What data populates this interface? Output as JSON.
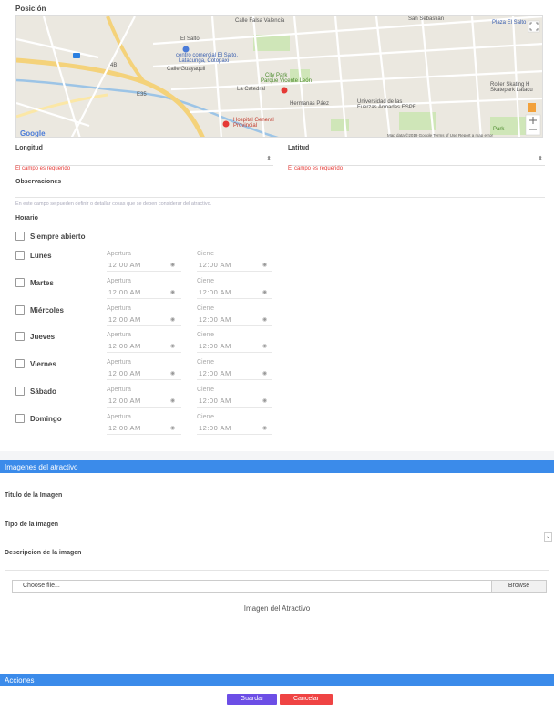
{
  "posicion": {
    "label": "Posición",
    "map": {
      "labels": {
        "calle_falsa_valencia": "Calle Falsa Valencia",
        "el_salto": "El Salto",
        "centro_comercial": "centro comercial El Salto,",
        "latacunga": "Latacunga, Cotopaxi",
        "calle_guayaquil": "Calle Guayaquil",
        "city_park": "City Park",
        "vicente_leon": "Parque Vicente León",
        "la_catedral": "La Catedral",
        "hermanas_paez": "Hermanas Páez",
        "universidad": "Universidad de las",
        "fuerzas": "Fuerzas Armadas ESPE",
        "hospital": "Hospital General",
        "provincial": "Provincial",
        "roller": "Roller Skating H",
        "skatepark": "Skatepark Latacu",
        "plaza": "Plaza El Salto",
        "san_sebastian": "San Sebastián",
        "park": "Park",
        "road_4b": "4B",
        "road_e35": "E35",
        "google": "Google",
        "footer": "Map data ©2019 Google  Terms of Use  Report a map error"
      }
    }
  },
  "longitud": {
    "label": "Longitud",
    "error": "El campo es requerido"
  },
  "latitud": {
    "label": "Latitud",
    "error": "El campo es requerido"
  },
  "observaciones": {
    "label": "Observaciones",
    "hint": "En este campo se pueden definir o detallar cosas que se deben considerar del atractivo."
  },
  "horario": {
    "label": "Horario",
    "siempre_abierto": "Siempre abierto",
    "apertura_label": "Apertura",
    "cierre_label": "Cierre",
    "days": [
      {
        "name": "Lunes",
        "apertura": "12:00 AM",
        "cierre": "12:00 AM"
      },
      {
        "name": "Martes",
        "apertura": "12:00 AM",
        "cierre": "12:00 AM"
      },
      {
        "name": "Miércoles",
        "apertura": "12:00 AM",
        "cierre": "12:00 AM"
      },
      {
        "name": "Jueves",
        "apertura": "12:00 AM",
        "cierre": "12:00 AM"
      },
      {
        "name": "Viernes",
        "apertura": "12:00 AM",
        "cierre": "12:00 AM"
      },
      {
        "name": "Sábado",
        "apertura": "12:00 AM",
        "cierre": "12:00 AM"
      },
      {
        "name": "Domingo",
        "apertura": "12:00 AM",
        "cierre": "12:00 AM"
      }
    ]
  },
  "imagenes": {
    "header": "Imagenes del atractivo",
    "titulo_label": "Titulo de la Imagen",
    "tipo_label": "Tipo de la imagen",
    "descripcion_label": "Descripcion de la imagen",
    "file_placeholder": "Choose file...",
    "browse": "Browse",
    "preview_text": "Imagen del Atractivo"
  },
  "acciones": {
    "header": "Acciones",
    "guardar": "Guardar",
    "cancelar": "Cancelar"
  },
  "colors": {
    "header_bar": "#3b8bea",
    "guardar": "#6c4ee6",
    "cancelar": "#ef4444",
    "error": "#e53935"
  }
}
